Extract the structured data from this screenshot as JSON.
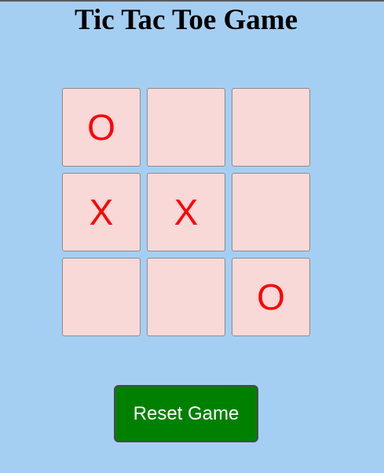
{
  "title": "Tic Tac Toe Game",
  "board": {
    "cells": [
      "O",
      "",
      "",
      "X",
      "X",
      "",
      "",
      "",
      "O"
    ]
  },
  "reset_label": "Reset Game",
  "colors": {
    "background": "#a5cff2",
    "cell_background": "#f9d8d8",
    "mark": "#ff0000",
    "reset_button": "#008000"
  }
}
